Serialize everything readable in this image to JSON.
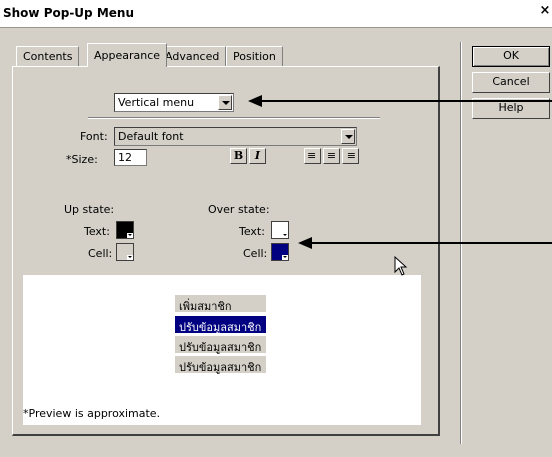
{
  "dialog": {
    "title": "Show Pop-Up Menu",
    "close_glyph": "×"
  },
  "tabs": [
    {
      "label": "Contents",
      "active": false
    },
    {
      "label": "Appearance",
      "active": true
    },
    {
      "label": "Advanced",
      "active": false
    },
    {
      "label": "Position",
      "active": false
    }
  ],
  "appearance": {
    "orientation_value": "Vertical menu",
    "font_label": "Font:",
    "font_value": "Default font",
    "size_label": "*Size:",
    "size_value": "12",
    "bold_label": "B",
    "italic_label": "I",
    "align_left_glyph": "≡",
    "align_center_glyph": "≡",
    "align_right_glyph": "≡",
    "up_state_label": "Up state:",
    "over_state_label": "Over state:",
    "text_label": "Text:",
    "cell_label": "Cell:",
    "colors": {
      "up_text": "#000000",
      "up_cell": "#cccccc",
      "over_text": "#ffffff",
      "over_cell": "#000080"
    }
  },
  "preview": {
    "items": [
      {
        "label": "เพิ่มสมาชิก",
        "highlighted": false
      },
      {
        "label": "ปรับข้อมูลสมาชิก",
        "highlighted": true
      },
      {
        "label": "ปรับข้อมูลสมาชิก",
        "highlighted": false
      },
      {
        "label": "ปรับข้อมูลสมาชิก",
        "highlighted": false
      }
    ],
    "note": "*Preview is approximate."
  },
  "buttons": {
    "ok": "OK",
    "cancel": "Cancel",
    "help": "Help"
  }
}
